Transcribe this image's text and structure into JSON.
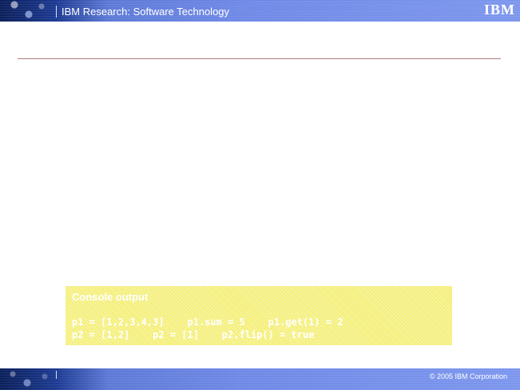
{
  "header": {
    "title": "IBM Research: Software Technology",
    "logo_text": "IBM"
  },
  "console": {
    "title": "Console output",
    "lines": [
      "p1 = [1,2,3,4,3]    p1.sum = 5    p1.get(1) = 2",
      "p2 = [1,2]    p2 = [1]    p2.flip() = true"
    ]
  },
  "footer": {
    "copyright": "© 2005 IBM Corporation"
  },
  "colors": {
    "header_bg_dark": "#0b1f5a",
    "header_bg_light": "#7d97ee",
    "rule": "#b07b7b",
    "console_bg": "#f4ef77",
    "console_text": "#ffffff"
  }
}
